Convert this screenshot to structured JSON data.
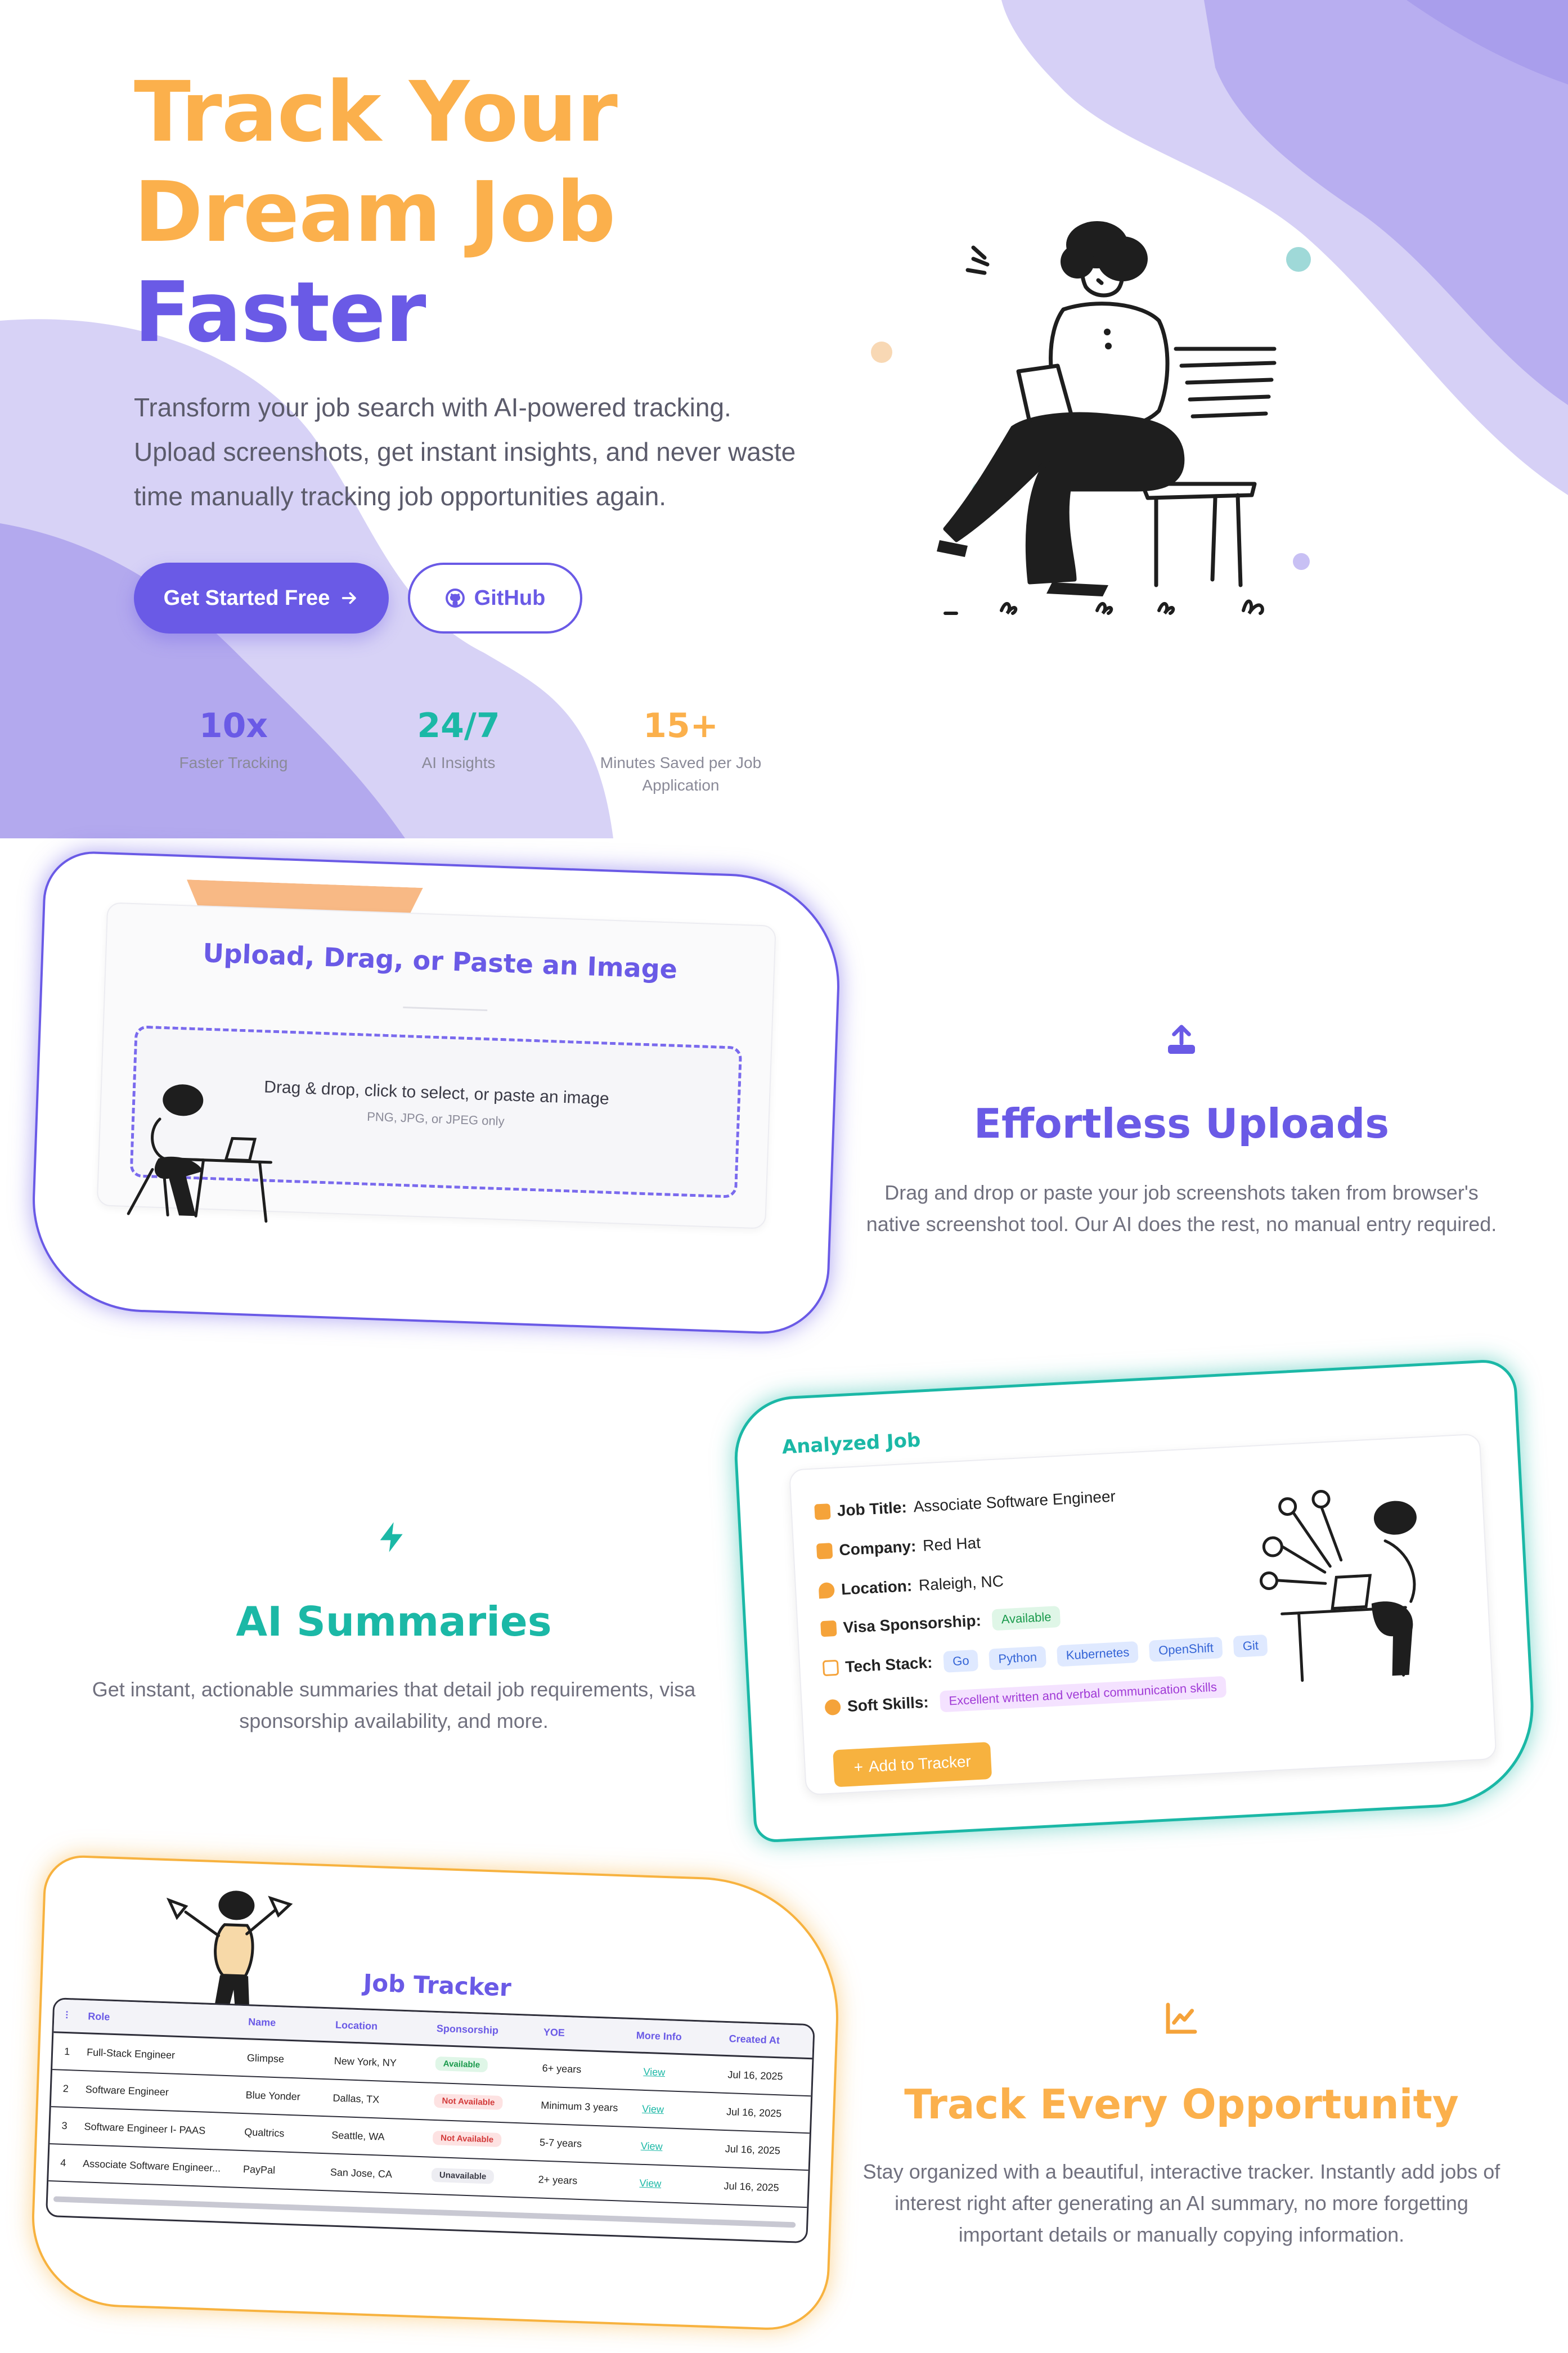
{
  "colors": {
    "purple": "#6a5ae6",
    "orange": "#fbb04c",
    "teal": "#1bb8a6"
  },
  "hero": {
    "title_line1": "Track Your",
    "title_line2": "Dream Job",
    "title_line3": "Faster",
    "description": "Transform your job search with AI-powered tracking. Upload screenshots, get instant insights, and never waste time manually tracking job opportunities again.",
    "primary_button": "Get Started Free",
    "secondary_button": "GitHub",
    "stats": [
      {
        "value": "10x",
        "label": "Faster Tracking"
      },
      {
        "value": "24/7",
        "label": "AI Insights"
      },
      {
        "value": "15+",
        "label": "Minutes Saved per Job Application"
      }
    ]
  },
  "uploads": {
    "card_title": "Upload, Drag, or Paste an Image",
    "drop_text": "Drag & drop, click to select, or paste an image",
    "drop_subtext": "PNG, JPG, or JPEG only",
    "icon": "upload-icon",
    "title": "Effortless Uploads",
    "description": "Drag and drop or paste your job screenshots taken from browser's native screenshot tool. Our AI does the rest, no manual entry required."
  },
  "summaries": {
    "icon": "lightning-icon",
    "title": "AI Summaries",
    "description": "Get instant, actionable summaries that detail job requirements, visa sponsorship availability, and more.",
    "card_label": "Analyzed Job",
    "job_title_key": "Job Title:",
    "job_title": "Associate Software Engineer",
    "company_key": "Company:",
    "company": "Red Hat",
    "location_key": "Location:",
    "location": "Raleigh, NC",
    "visa_key": "Visa Sponsorship:",
    "visa": "Available",
    "tech_key": "Tech Stack:",
    "tech": [
      "Go",
      "Python",
      "Kubernetes",
      "OpenShift",
      "Git"
    ],
    "soft_key": "Soft Skills:",
    "soft": "Excellent written and verbal communication skills",
    "add_button": "Add to Tracker"
  },
  "tracker": {
    "icon": "chart-icon",
    "title": "Track Every Opportunity",
    "description": "Stay organized with a beautiful, interactive tracker. Instantly add jobs of interest right after generating an AI summary, no more forgetting important details or manually copying information.",
    "table_title": "Job Tracker",
    "columns": [
      "Role",
      "Name",
      "Location",
      "Sponsorship",
      "YOE",
      "More Info",
      "Created At"
    ],
    "rows": [
      {
        "n": "1",
        "role": "Full-Stack Engineer",
        "name": "Glimpse",
        "location": "New York, NY",
        "sponsorship": "Available",
        "yoe": "6+ years",
        "info": "View",
        "created": "Jul 16, 2025"
      },
      {
        "n": "2",
        "role": "Software Engineer",
        "name": "Blue Yonder",
        "location": "Dallas, TX",
        "sponsorship": "Not Available",
        "yoe": "Minimum 3 years",
        "info": "View",
        "created": "Jul 16, 2025"
      },
      {
        "n": "3",
        "role": "Software Engineer I- PAAS",
        "name": "Qualtrics",
        "location": "Seattle, WA",
        "sponsorship": "Not Available",
        "yoe": "5-7 years",
        "info": "View",
        "created": "Jul 16, 2025"
      },
      {
        "n": "4",
        "role": "Associate Software Engineer...",
        "name": "PayPal",
        "location": "San Jose, CA",
        "sponsorship": "Unavailable",
        "yoe": "2+ years",
        "info": "View",
        "created": "Jul 16, 2025"
      }
    ]
  }
}
